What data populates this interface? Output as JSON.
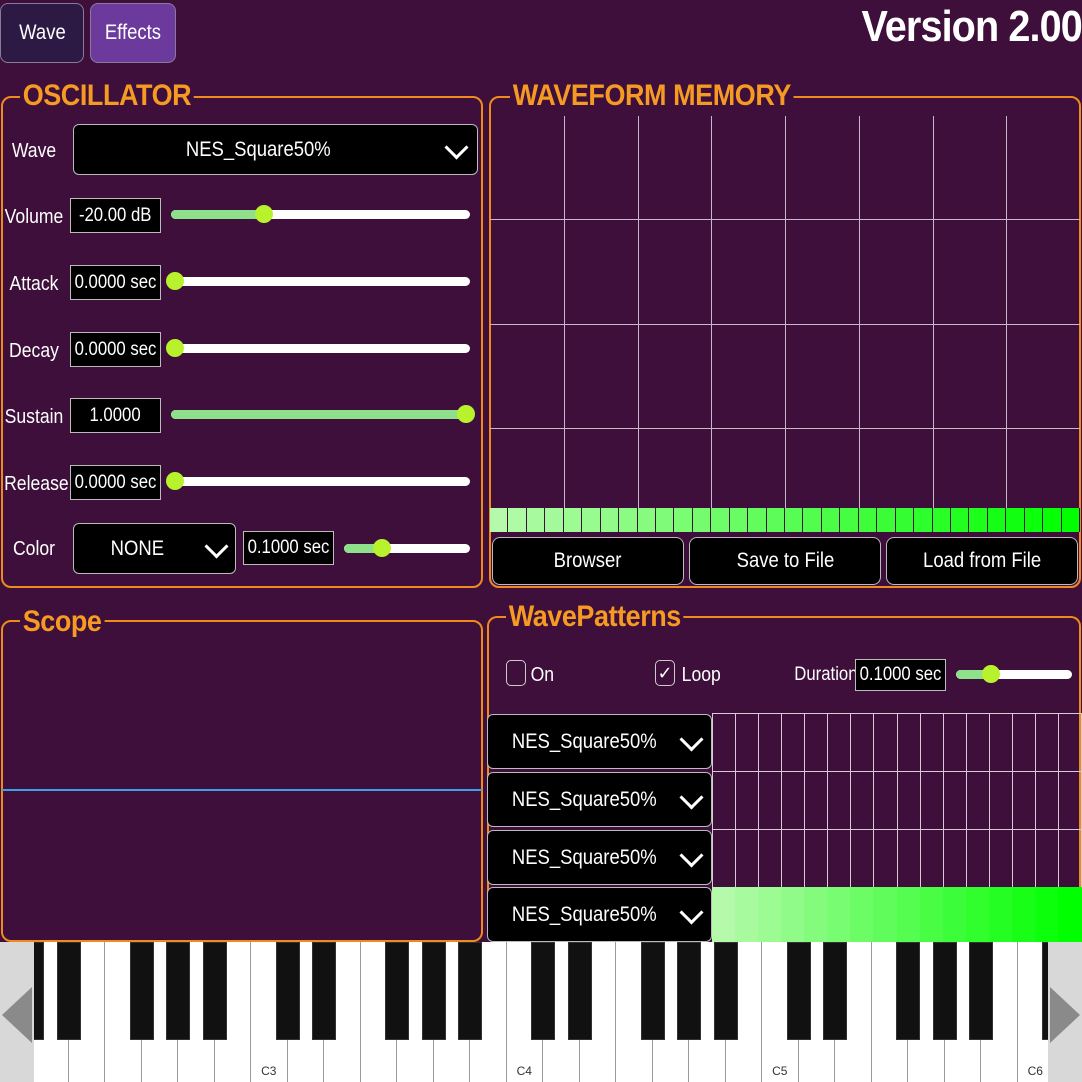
{
  "tabs": [
    {
      "label": "Wave",
      "active": false
    },
    {
      "label": "Effects",
      "active": true
    }
  ],
  "version": "Version 2.00",
  "colors": {
    "background": "#3d0f3a",
    "accent": "#f08a1c",
    "title": "#f59a22",
    "slider_fill": "#8fe08a",
    "thumb": "#b8f22c",
    "scope_line": "#3aa0e8"
  },
  "oscillator": {
    "title": "OSCILLATOR",
    "wave": {
      "label": "Wave",
      "value": "NES_Square50%"
    },
    "params": [
      {
        "label": "Volume",
        "value": "-20.00 dB",
        "level": 0.31
      },
      {
        "label": "Attack",
        "value": "0.0000 sec",
        "level": 0.0
      },
      {
        "label": "Decay",
        "value": "0.0000 sec",
        "level": 0.0
      },
      {
        "label": "Sustain",
        "value": "1.0000",
        "level": 1.0
      },
      {
        "label": "Release",
        "value": "0.0000 sec",
        "level": 0.0
      }
    ],
    "color": {
      "label": "Color",
      "value": "NONE",
      "time": "0.1000 sec",
      "level": 0.3
    }
  },
  "waveform_memory": {
    "title": "WAVEFORM MEMORY",
    "buttons": [
      "Browser",
      "Save to File",
      "Load from File"
    ],
    "cells": 32
  },
  "scope": {
    "title": "Scope"
  },
  "wave_patterns": {
    "title": "WavePatterns",
    "on_label": "On",
    "on_checked": false,
    "loop_label": "Loop",
    "loop_checked": true,
    "duration_label": "Duration",
    "duration_value": "0.1000 sec",
    "duration_level": 0.3,
    "check_glyph": "✓",
    "rows": [
      "NES_Square50%",
      "NES_Square50%",
      "NES_Square50%",
      "NES_Square50%"
    ],
    "steps": 16
  },
  "keyboard": {
    "octave_labels": [
      "C3",
      "C4",
      "C5",
      "C6"
    ]
  }
}
